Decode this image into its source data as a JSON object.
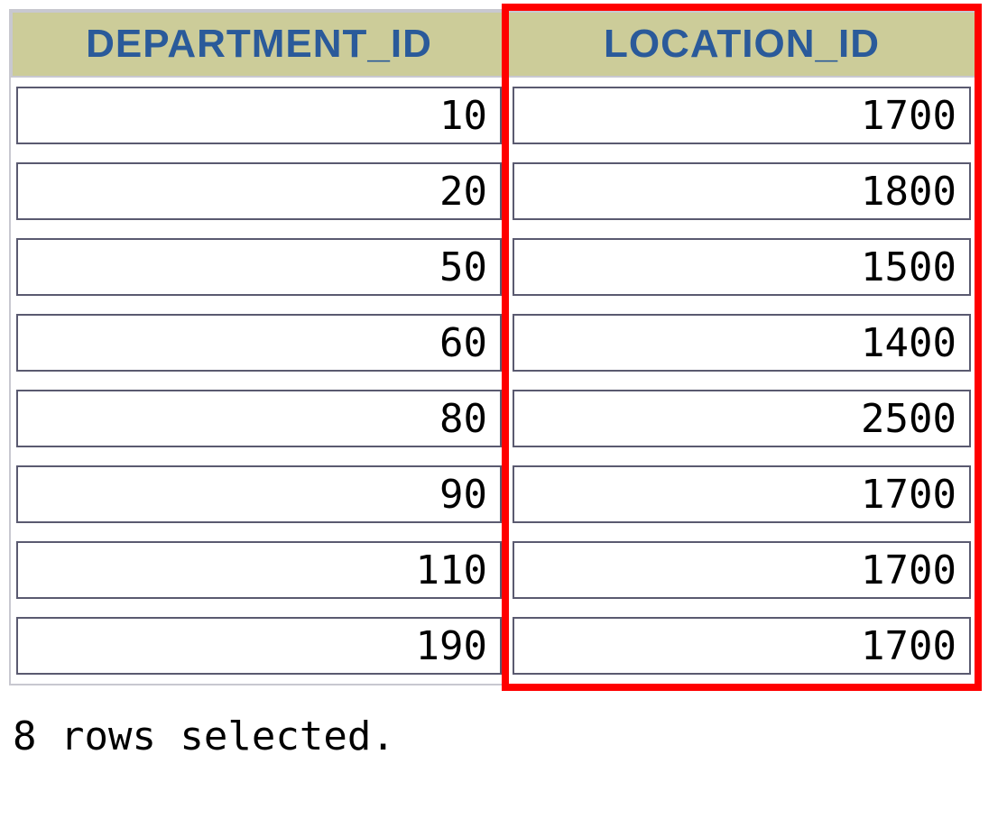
{
  "table": {
    "columns": [
      {
        "header": "DEPARTMENT_ID"
      },
      {
        "header": "LOCATION_ID"
      }
    ],
    "rows": [
      {
        "department_id": "10",
        "location_id": "1700"
      },
      {
        "department_id": "20",
        "location_id": "1800"
      },
      {
        "department_id": "50",
        "location_id": "1500"
      },
      {
        "department_id": "60",
        "location_id": "1400"
      },
      {
        "department_id": "80",
        "location_id": "2500"
      },
      {
        "department_id": "90",
        "location_id": "1700"
      },
      {
        "department_id": "110",
        "location_id": "1700"
      },
      {
        "department_id": "190",
        "location_id": "1700"
      }
    ]
  },
  "status": "8 rows selected.",
  "highlight": {
    "column_index": 1
  }
}
